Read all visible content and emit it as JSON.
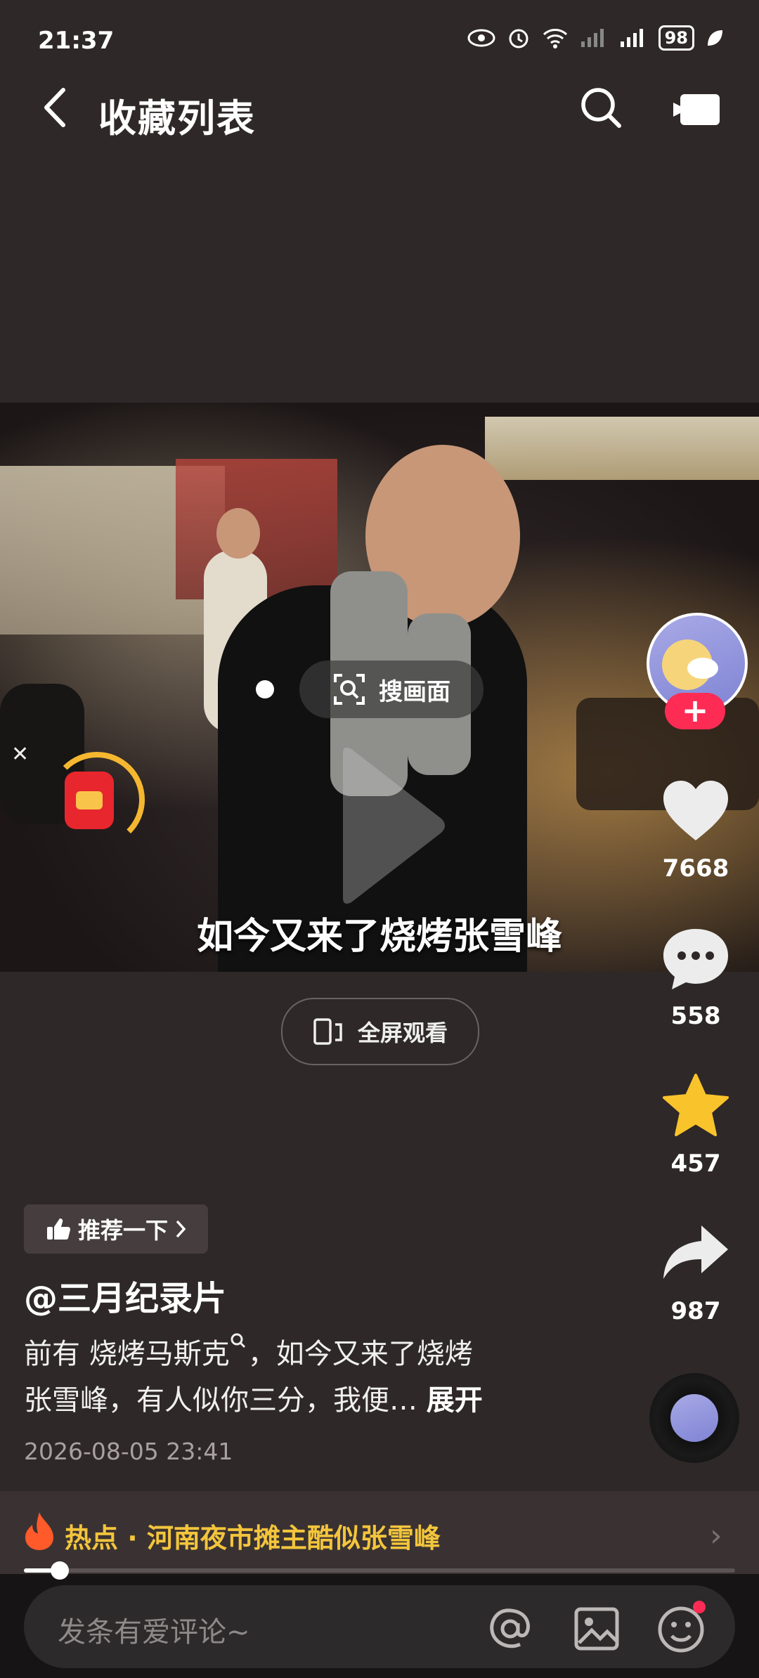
{
  "status_bar": {
    "time": "21:37",
    "battery": "98"
  },
  "header": {
    "title": "收藏列表"
  },
  "video": {
    "search_label": "搜画面",
    "caption": "如今又来了烧烤张雪峰"
  },
  "rail": {
    "follow": "+",
    "likes": "7668",
    "comments": "558",
    "favorites": "457",
    "shares": "987"
  },
  "fullscreen_label": "全屏观看",
  "info": {
    "recommend_label": "推荐一下",
    "author": "@三月纪录片",
    "desc_part1": "前有 烧烤马斯克",
    "desc_part2": "，如今又来了烧烤",
    "desc_line2": "张雪峰，有人似你三分，我便…",
    "expand": "展开",
    "date": "2026-08-05 23:41"
  },
  "hot": {
    "label": "热点 · 河南夜市摊主酷似张雪峰"
  },
  "playback": {
    "progress": 0.05
  },
  "comment": {
    "placeholder": "发条有爱评论~"
  },
  "colors": {
    "accent": "#fe2c55",
    "hot": "#f3c53c",
    "background": "#2f2828"
  }
}
